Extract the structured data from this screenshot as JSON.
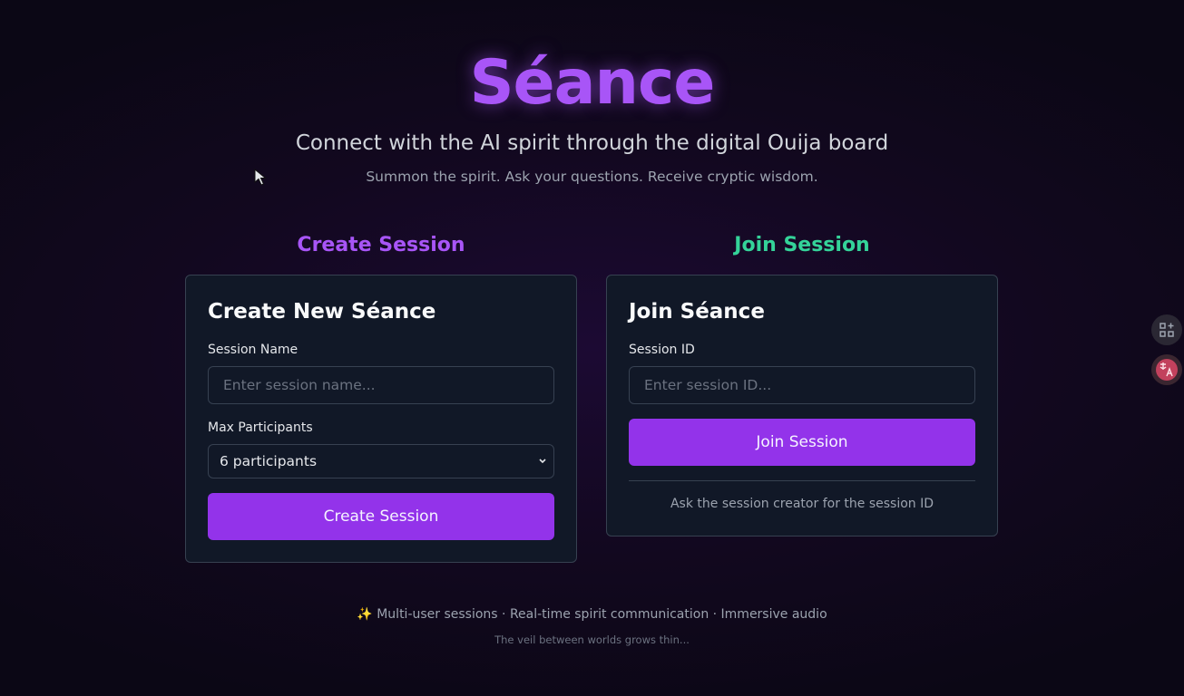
{
  "app": {
    "title": "Séance",
    "subtitle": "Connect with the AI spirit through the digital Ouija board",
    "tagline": "Summon the spirit. Ask your questions. Receive cryptic wisdom."
  },
  "create": {
    "heading": "Create Session",
    "card_title": "Create New Séance",
    "session_name_label": "Session Name",
    "session_name_placeholder": "Enter session name...",
    "session_name_value": "",
    "max_participants_label": "Max Participants",
    "max_participants_value": "6 participants",
    "button_label": "Create Session"
  },
  "join": {
    "heading": "Join Session",
    "card_title": "Join Séance",
    "session_id_label": "Session ID",
    "session_id_placeholder": "Enter session ID...",
    "session_id_value": "",
    "button_label": "Join Session",
    "hint": "Ask the session creator for the session ID"
  },
  "footer": {
    "features": "✨ Multi-user sessions · Real-time spirit communication · Immersive audio",
    "note": "The veil between worlds grows thin..."
  },
  "icons": {
    "chevron": "chevron-down-icon",
    "apps": "apps-icon",
    "translate": "translate-icon",
    "cursor": "mouse-cursor-icon"
  },
  "colors": {
    "accent_purple": "#a855f7",
    "button_purple": "#9333ea",
    "join_green": "#34d399",
    "card_bg": "#111827",
    "page_bg": "#0b0715"
  }
}
